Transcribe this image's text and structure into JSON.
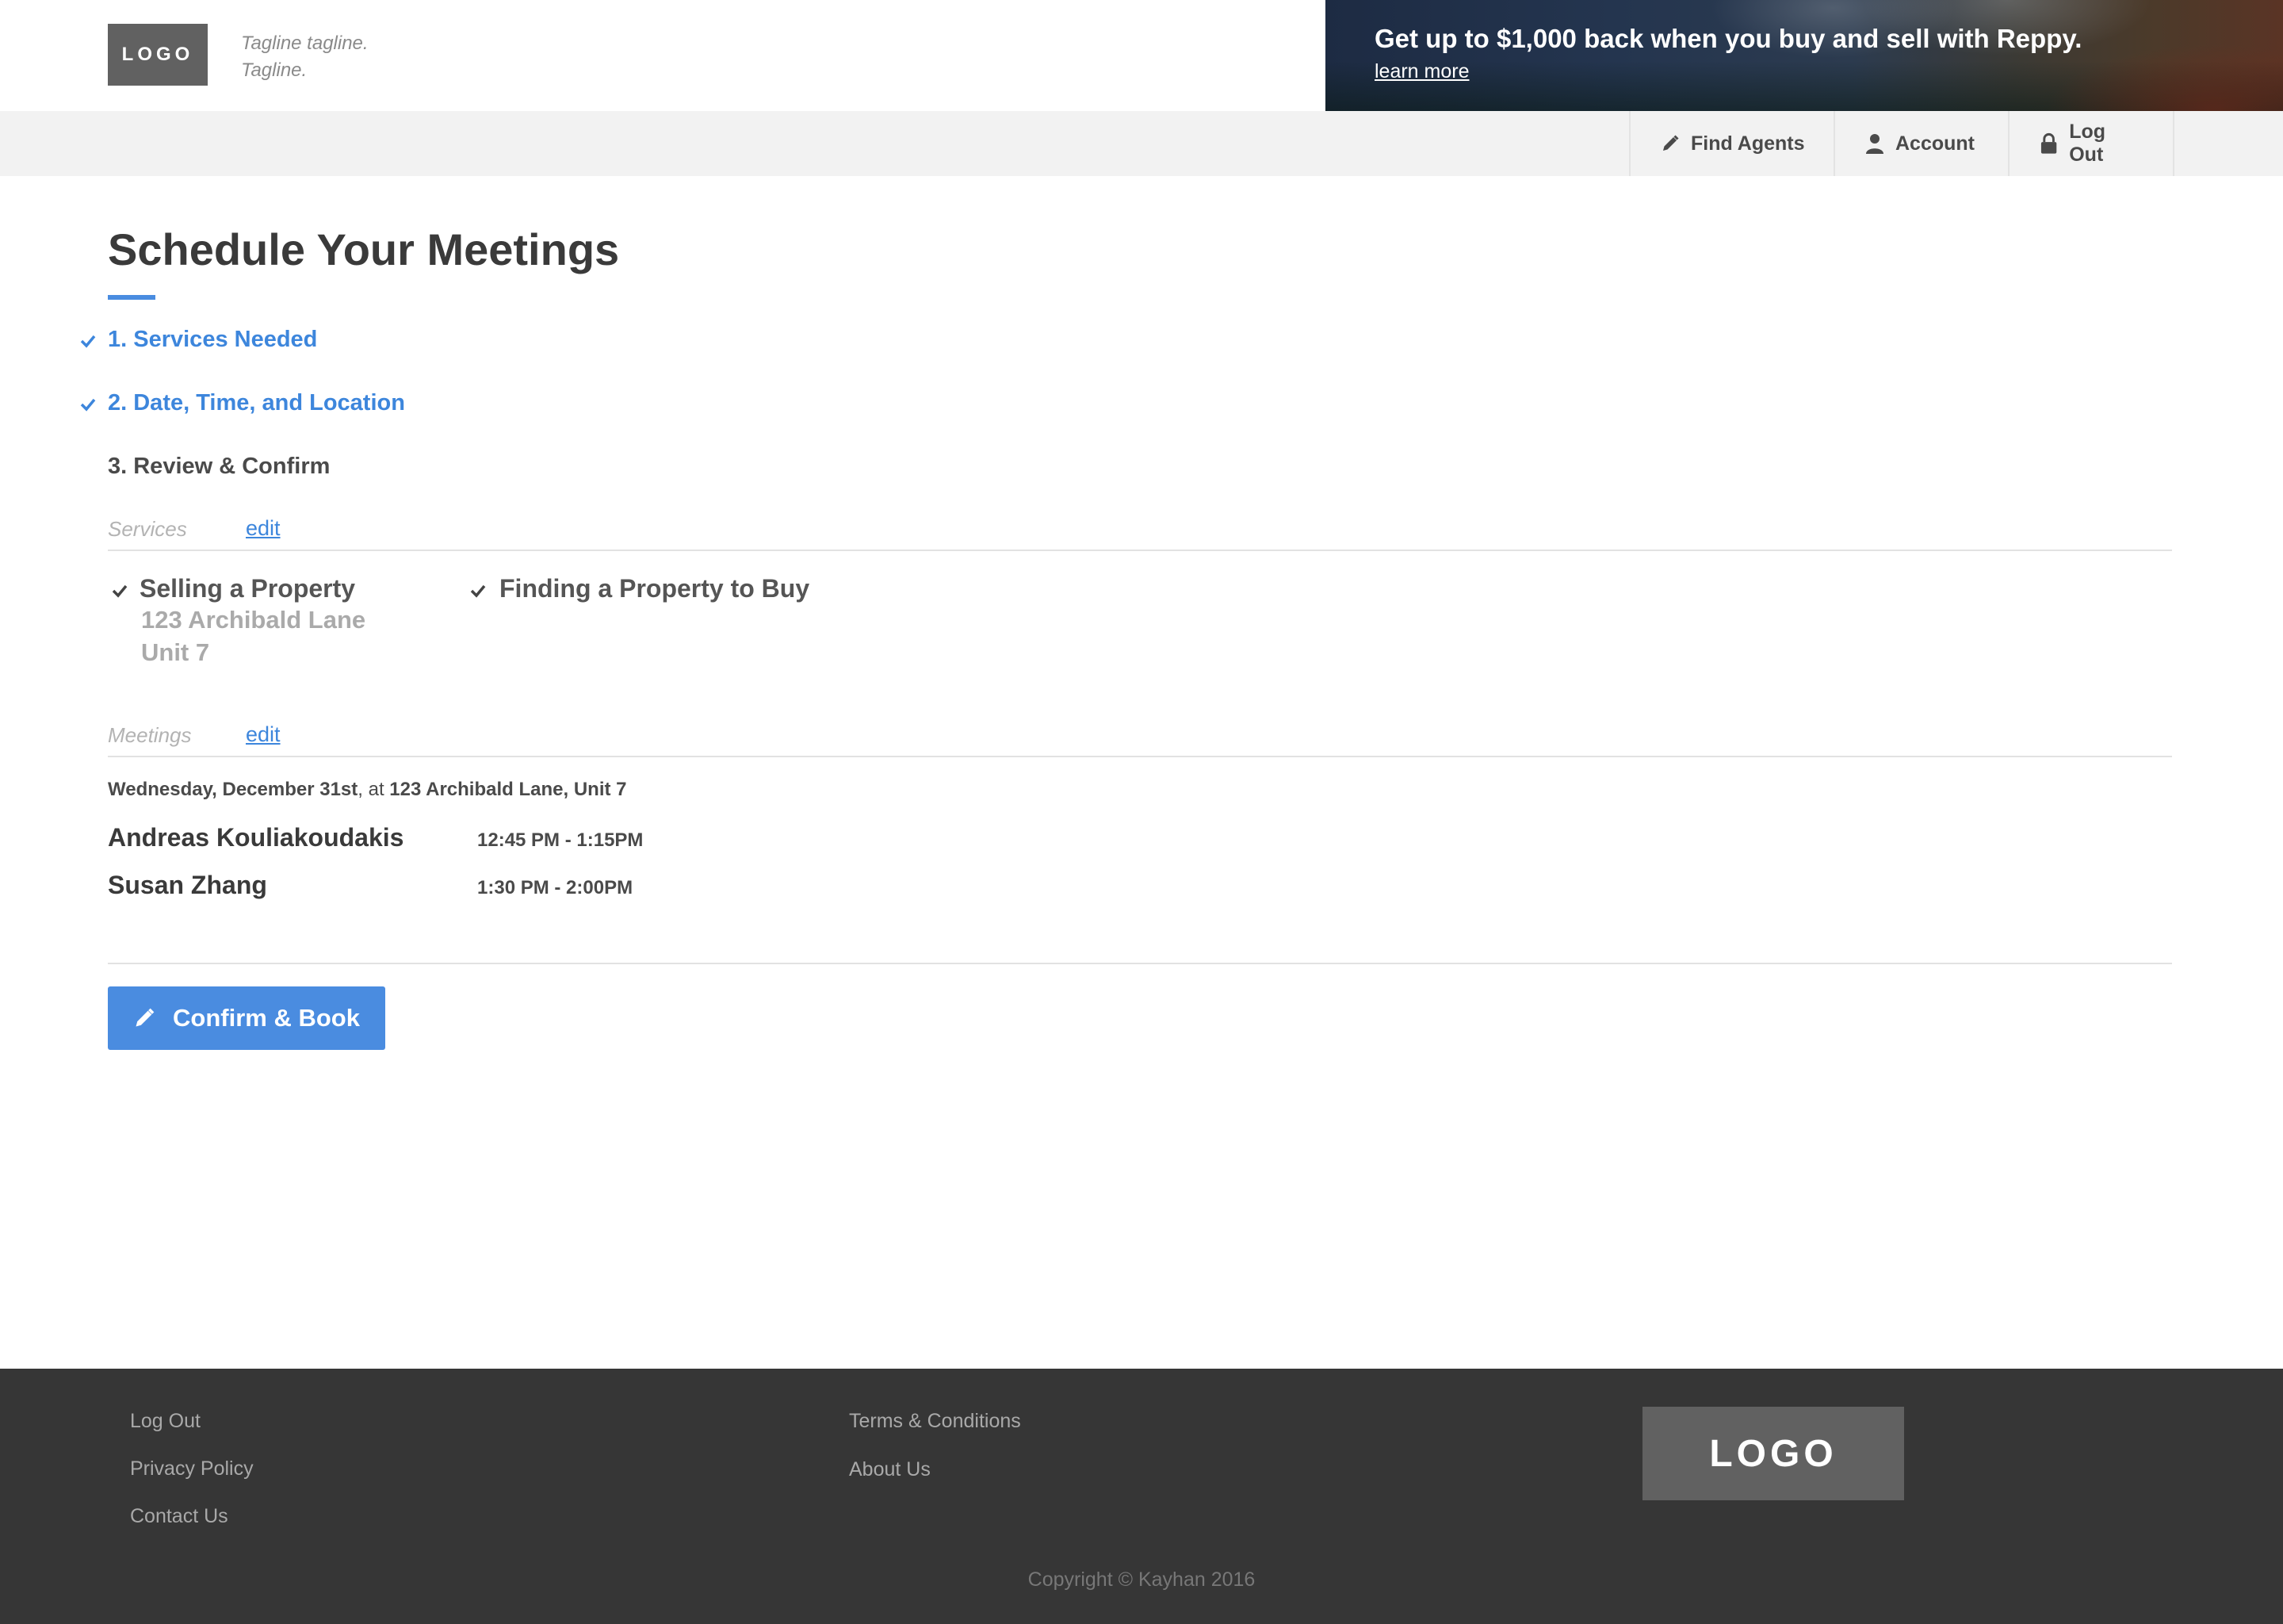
{
  "header": {
    "logo_text": "LOGO",
    "tagline_line1": "Tagline tagline.",
    "tagline_line2": "Tagline.",
    "banner": {
      "title": "Get up to $1,000 back when you buy and sell with Reppy.",
      "link": "learn more"
    }
  },
  "nav": {
    "items": [
      {
        "label": "Find Agents",
        "icon": "pencil-icon"
      },
      {
        "label": "Account",
        "icon": "person-icon"
      },
      {
        "label": "Log Out",
        "icon": "lock-icon"
      }
    ]
  },
  "main": {
    "title": "Schedule Your Meetings",
    "steps": [
      {
        "label": "1. Services Needed",
        "status": "completed"
      },
      {
        "label": "2. Date, Time, and Location",
        "status": "completed"
      },
      {
        "label": "3. Review & Confirm",
        "status": "current"
      }
    ],
    "services_section": {
      "label": "Services",
      "edit": "edit",
      "items": [
        {
          "title": "Selling a Property",
          "address_line1": "123 Archibald Lane",
          "address_line2": "Unit 7"
        },
        {
          "title": "Finding a Property to Buy"
        }
      ]
    },
    "meetings_section": {
      "label": "Meetings",
      "edit": "edit",
      "date": "Wednesday, December 31st",
      "at_text": ", at ",
      "location": "123 Archibald Lane, Unit 7",
      "meetings": [
        {
          "agent": "Andreas Kouliakoudakis",
          "time": "12:45 PM - 1:15PM"
        },
        {
          "agent": "Susan Zhang",
          "time": "1:30 PM - 2:00PM"
        }
      ]
    },
    "confirm_button": "Confirm & Book"
  },
  "footer": {
    "col1": [
      "Log Out",
      "Privacy Policy",
      "Contact Us"
    ],
    "col2": [
      "Terms & Conditions",
      "About Us"
    ],
    "logo_text": "LOGO",
    "copyright": "Copyright © Kayhan 2016"
  },
  "colors": {
    "accent": "#4a8ce0",
    "link": "#3d86dc",
    "footer_bg": "#363636",
    "nav_bg": "#f2f2f2",
    "logo_bg": "#616161"
  }
}
